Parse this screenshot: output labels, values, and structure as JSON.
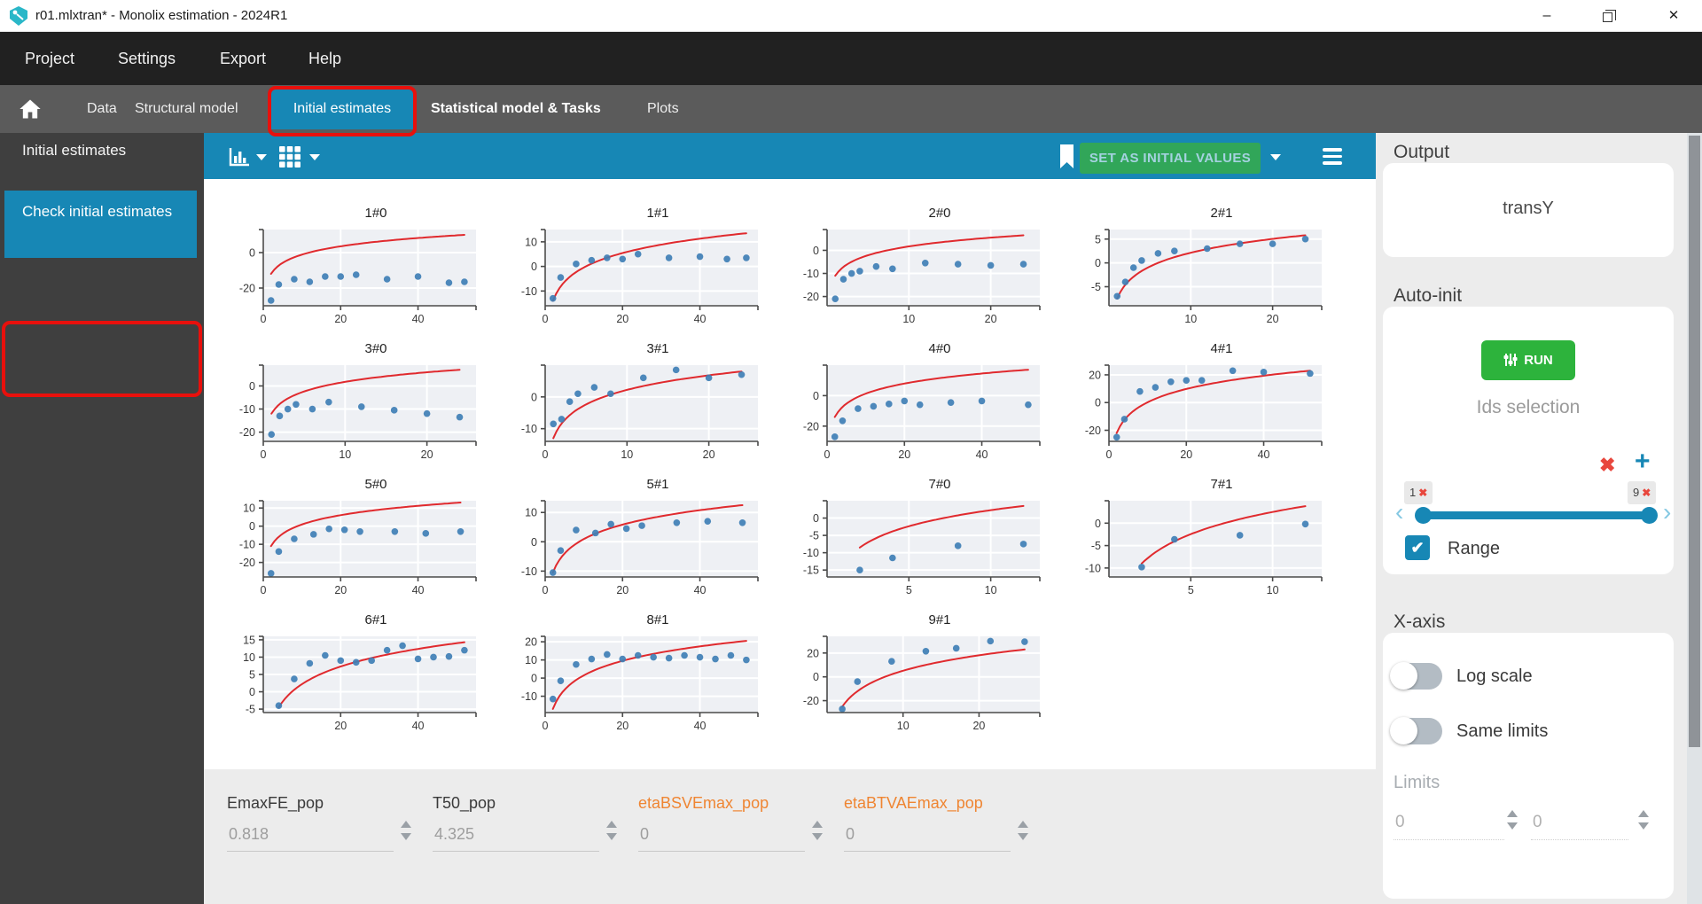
{
  "window": {
    "title": "r01.mlxtran* - Monolix estimation - 2024R1"
  },
  "menu": {
    "items": [
      "Project",
      "Settings",
      "Export",
      "Help"
    ]
  },
  "nav": {
    "tabs": [
      "Data",
      "Structural model",
      "Initial estimates",
      "Statistical model & Tasks",
      "Plots"
    ],
    "active_tab": "Initial estimates"
  },
  "sidebar": {
    "title": "Initial estimates",
    "selected_item": "Check initial estimates"
  },
  "toolbar": {
    "set_button": "SET AS INITIAL VALUES"
  },
  "parameters": [
    {
      "name": "EmaxFE_pop",
      "value": "0.818",
      "highlighted": false
    },
    {
      "name": "T50_pop",
      "value": "4.325",
      "highlighted": false
    },
    {
      "name": "etaBSVEmax_pop",
      "value": "0",
      "highlighted": true
    },
    {
      "name": "etaBTVAEmax_pop",
      "value": "0",
      "highlighted": true
    }
  ],
  "output_panel": {
    "title": "Output",
    "value": "transY"
  },
  "auto_init_panel": {
    "title": "Auto-init",
    "run_button": "RUN",
    "ids_title": "Ids selection",
    "id_min": "1",
    "id_max": "9",
    "range_label": "Range",
    "range_checked": true
  },
  "x_axis_panel": {
    "title": "X-axis",
    "log_scale_label": "Log scale",
    "log_scale_on": false,
    "same_limits_label": "Same limits",
    "same_limits_on": false,
    "limits_label": "Limits",
    "limit_min_placeholder": "0",
    "limit_max_placeholder": "0"
  },
  "colors": {
    "accent_blue": "#1787b5",
    "run_green": "#2db33c",
    "set_button_green": "#31a659",
    "annotation_red": "#e8100c",
    "highlight_orange": "#ef8532",
    "scatter_dot": "#3f7fb5",
    "fit_curve": "#e02a2e"
  },
  "chart_data": [
    {
      "id": "1#0",
      "row": 0,
      "col": 0,
      "type": "scatter",
      "xlim": [
        0,
        55
      ],
      "ylim": [
        -30,
        13
      ],
      "xticks": [
        0,
        20,
        40
      ],
      "yticks": [
        0,
        -20
      ],
      "points": [
        [
          2,
          -27
        ],
        [
          4,
          -18
        ],
        [
          8,
          -15
        ],
        [
          12,
          -16.5
        ],
        [
          16,
          -13.5
        ],
        [
          20,
          -13.5
        ],
        [
          24,
          -12.5
        ],
        [
          32,
          -15
        ],
        [
          40,
          -13.5
        ],
        [
          48,
          -17
        ],
        [
          52,
          -16.5
        ]
      ],
      "fit_curve": {
        "type": "log",
        "x": [
          2,
          52
        ],
        "y": [
          -12,
          10
        ]
      }
    },
    {
      "id": "1#1",
      "row": 0,
      "col": 1,
      "type": "scatter",
      "xlim": [
        0,
        55
      ],
      "ylim": [
        -16,
        15
      ],
      "xticks": [
        0,
        20,
        40
      ],
      "yticks": [
        10,
        0,
        -10
      ],
      "points": [
        [
          2,
          -13
        ],
        [
          4,
          -4.5
        ],
        [
          8,
          1
        ],
        [
          12,
          2.5
        ],
        [
          16,
          3.5
        ],
        [
          20,
          3
        ],
        [
          24,
          5
        ],
        [
          32,
          3.5
        ],
        [
          40,
          4
        ],
        [
          47,
          3
        ],
        [
          52,
          3.5
        ]
      ],
      "fit_curve": {
        "type": "log",
        "x": [
          2,
          52
        ],
        "y": [
          -14,
          13.5
        ]
      }
    },
    {
      "id": "2#0",
      "row": 0,
      "col": 2,
      "type": "scatter",
      "xlim": [
        0,
        26
      ],
      "ylim": [
        -24,
        9
      ],
      "xticks": [
        10,
        20
      ],
      "yticks": [
        0,
        -10,
        -20
      ],
      "points": [
        [
          1,
          -21
        ],
        [
          2,
          -12.5
        ],
        [
          3,
          -10
        ],
        [
          4,
          -9
        ],
        [
          6,
          -7
        ],
        [
          8,
          -8
        ],
        [
          12,
          -5.5
        ],
        [
          16,
          -6
        ],
        [
          20,
          -6.5
        ],
        [
          24,
          -6
        ]
      ],
      "fit_curve": {
        "type": "log",
        "x": [
          1,
          24
        ],
        "y": [
          -11,
          6.5
        ]
      }
    },
    {
      "id": "2#1",
      "row": 0,
      "col": 3,
      "type": "scatter",
      "xlim": [
        0,
        26
      ],
      "ylim": [
        -9,
        7
      ],
      "xticks": [
        10,
        20
      ],
      "yticks": [
        5,
        0,
        -5
      ],
      "points": [
        [
          1,
          -7
        ],
        [
          2,
          -4
        ],
        [
          3,
          -1
        ],
        [
          4,
          0.5
        ],
        [
          6,
          2
        ],
        [
          8,
          2.5
        ],
        [
          12,
          3
        ],
        [
          16,
          4
        ],
        [
          20,
          4
        ],
        [
          24,
          5
        ]
      ],
      "fit_curve": {
        "type": "log",
        "x": [
          1,
          24
        ],
        "y": [
          -7.5,
          5.8
        ]
      }
    },
    {
      "id": "3#0",
      "row": 1,
      "col": 0,
      "type": "scatter",
      "xlim": [
        0,
        26
      ],
      "ylim": [
        -24,
        9
      ],
      "xticks": [
        0,
        10,
        20
      ],
      "yticks": [
        0,
        -10,
        -20
      ],
      "points": [
        [
          1,
          -21
        ],
        [
          2,
          -13
        ],
        [
          3,
          -10
        ],
        [
          4,
          -8
        ],
        [
          6,
          -10
        ],
        [
          8,
          -7
        ],
        [
          12,
          -9
        ],
        [
          16,
          -10.5
        ],
        [
          20,
          -12
        ],
        [
          24,
          -13.5
        ]
      ],
      "fit_curve": {
        "type": "log",
        "x": [
          1,
          24
        ],
        "y": [
          -12,
          7
        ]
      }
    },
    {
      "id": "3#1",
      "row": 1,
      "col": 1,
      "type": "scatter",
      "xlim": [
        0,
        26
      ],
      "ylim": [
        -14,
        10
      ],
      "xticks": [
        0,
        10,
        20
      ],
      "yticks": [
        0,
        -10
      ],
      "points": [
        [
          1,
          -8.5
        ],
        [
          2,
          -7
        ],
        [
          3,
          -1.5
        ],
        [
          4,
          1
        ],
        [
          6,
          3
        ],
        [
          8,
          1
        ],
        [
          12,
          6
        ],
        [
          16,
          8.5
        ],
        [
          20,
          6
        ],
        [
          24,
          7
        ]
      ],
      "fit_curve": {
        "type": "log",
        "x": [
          1,
          24
        ],
        "y": [
          -13,
          8
        ]
      }
    },
    {
      "id": "4#0",
      "row": 1,
      "col": 2,
      "type": "scatter",
      "xlim": [
        0,
        55
      ],
      "ylim": [
        -30,
        20
      ],
      "xticks": [
        0,
        20,
        40
      ],
      "yticks": [
        0,
        -20
      ],
      "points": [
        [
          2,
          -27
        ],
        [
          4,
          -16.5
        ],
        [
          8,
          -8.5
        ],
        [
          12,
          -7
        ],
        [
          16,
          -5.5
        ],
        [
          20,
          -3.5
        ],
        [
          24,
          -6
        ],
        [
          32,
          -4.5
        ],
        [
          40,
          -3.5
        ],
        [
          52,
          -6
        ]
      ],
      "fit_curve": {
        "type": "log",
        "x": [
          2,
          52
        ],
        "y": [
          -14,
          17
        ]
      }
    },
    {
      "id": "4#1",
      "row": 1,
      "col": 3,
      "type": "scatter",
      "xlim": [
        0,
        55
      ],
      "ylim": [
        -28,
        27
      ],
      "xticks": [
        0,
        20,
        40
      ],
      "yticks": [
        20,
        0,
        -20
      ],
      "points": [
        [
          2,
          -25
        ],
        [
          4,
          -12
        ],
        [
          8,
          8
        ],
        [
          12,
          11
        ],
        [
          16,
          15
        ],
        [
          20,
          16
        ],
        [
          24,
          16
        ],
        [
          32,
          23
        ],
        [
          40,
          22
        ],
        [
          52,
          21
        ]
      ],
      "fit_curve": {
        "type": "log",
        "x": [
          2,
          52
        ],
        "y": [
          -22,
          23
        ]
      }
    },
    {
      "id": "5#0",
      "row": 2,
      "col": 0,
      "type": "scatter",
      "xlim": [
        0,
        55
      ],
      "ylim": [
        -28,
        14
      ],
      "xticks": [
        0,
        20,
        40
      ],
      "yticks": [
        10,
        0,
        -10,
        -20
      ],
      "points": [
        [
          2,
          -26
        ],
        [
          4,
          -14
        ],
        [
          8,
          -7
        ],
        [
          13,
          -4.5
        ],
        [
          17,
          -1.5
        ],
        [
          21,
          -2
        ],
        [
          25,
          -3
        ],
        [
          34,
          -3
        ],
        [
          42,
          -4
        ],
        [
          51,
          -3
        ]
      ],
      "fit_curve": {
        "type": "log",
        "x": [
          2,
          51
        ],
        "y": [
          -11,
          13
        ]
      }
    },
    {
      "id": "5#1",
      "row": 2,
      "col": 1,
      "type": "scatter",
      "xlim": [
        0,
        55
      ],
      "ylim": [
        -12,
        14
      ],
      "xticks": [
        0,
        20,
        40
      ],
      "yticks": [
        10,
        0,
        -10
      ],
      "points": [
        [
          2,
          -10.5
        ],
        [
          4,
          -3
        ],
        [
          8,
          4
        ],
        [
          13,
          3
        ],
        [
          17,
          6
        ],
        [
          21,
          4.5
        ],
        [
          25,
          5.5
        ],
        [
          34,
          6.5
        ],
        [
          42,
          7
        ],
        [
          51,
          6.5
        ]
      ],
      "fit_curve": {
        "type": "log",
        "x": [
          2,
          51
        ],
        "y": [
          -10.5,
          12.5
        ]
      }
    },
    {
      "id": "7#0",
      "row": 2,
      "col": 2,
      "type": "scatter",
      "xlim": [
        0,
        13
      ],
      "ylim": [
        -17,
        5
      ],
      "xticks": [
        5,
        10
      ],
      "yticks": [
        0,
        -5,
        -10,
        -15
      ],
      "points": [
        [
          2,
          -15
        ],
        [
          4,
          -11.5
        ],
        [
          8,
          -8
        ],
        [
          12,
          -7.5
        ]
      ],
      "fit_curve": {
        "type": "log",
        "x": [
          2,
          12
        ],
        "y": [
          -8.5,
          3.5
        ]
      }
    },
    {
      "id": "7#1",
      "row": 2,
      "col": 3,
      "type": "scatter",
      "xlim": [
        0,
        13
      ],
      "ylim": [
        -12,
        5
      ],
      "xticks": [
        5,
        10
      ],
      "yticks": [
        0,
        -5,
        -10
      ],
      "points": [
        [
          2,
          -9.8
        ],
        [
          4,
          -3.6
        ],
        [
          8,
          -2.7
        ],
        [
          12,
          -0.2
        ]
      ],
      "fit_curve": {
        "type": "log",
        "x": [
          2,
          12
        ],
        "y": [
          -9,
          3.8
        ]
      }
    },
    {
      "id": "6#1",
      "row": 3,
      "col": 0,
      "type": "scatter",
      "xlim": [
        0,
        55
      ],
      "ylim": [
        -6,
        16
      ],
      "xticks": [
        20,
        40
      ],
      "yticks": [
        15,
        10,
        5,
        0,
        -5
      ],
      "points": [
        [
          4,
          -4
        ],
        [
          8,
          3.7
        ],
        [
          12,
          8.2
        ],
        [
          16,
          10.5
        ],
        [
          20,
          9
        ],
        [
          24,
          8.5
        ],
        [
          28,
          9
        ],
        [
          32,
          12
        ],
        [
          36,
          13.3
        ],
        [
          40,
          9.5
        ],
        [
          44,
          10
        ],
        [
          48,
          10.2
        ],
        [
          52,
          12
        ]
      ],
      "fit_curve": {
        "type": "log",
        "x": [
          4,
          52
        ],
        "y": [
          -4.5,
          14.3
        ]
      }
    },
    {
      "id": "8#1",
      "row": 3,
      "col": 1,
      "type": "scatter",
      "xlim": [
        0,
        55
      ],
      "ylim": [
        -19,
        23
      ],
      "xticks": [
        0,
        20,
        40
      ],
      "yticks": [
        20,
        10,
        0,
        -10
      ],
      "points": [
        [
          2,
          -11.5
        ],
        [
          4,
          -1.5
        ],
        [
          8,
          7.5
        ],
        [
          12,
          10.5
        ],
        [
          16,
          13
        ],
        [
          20,
          10.5
        ],
        [
          24,
          12.5
        ],
        [
          28,
          11.5
        ],
        [
          32,
          11
        ],
        [
          36,
          12.5
        ],
        [
          40,
          11.5
        ],
        [
          44,
          10.5
        ],
        [
          48,
          12.5
        ],
        [
          52,
          10
        ]
      ],
      "fit_curve": {
        "type": "log",
        "x": [
          2,
          52
        ],
        "y": [
          -17,
          20.5
        ]
      }
    },
    {
      "id": "9#1",
      "row": 3,
      "col": 2,
      "type": "scatter",
      "xlim": [
        0,
        28
      ],
      "ylim": [
        -30,
        34
      ],
      "xticks": [
        10,
        20
      ],
      "yticks": [
        20,
        0,
        -20
      ],
      "points": [
        [
          2,
          -27
        ],
        [
          4,
          -4
        ],
        [
          8.5,
          13
        ],
        [
          13,
          21.5
        ],
        [
          17,
          24
        ],
        [
          21.5,
          30
        ],
        [
          26,
          29.5
        ]
      ],
      "fit_curve": {
        "type": "log",
        "x": [
          2,
          26
        ],
        "y": [
          -25,
          23
        ]
      }
    }
  ]
}
